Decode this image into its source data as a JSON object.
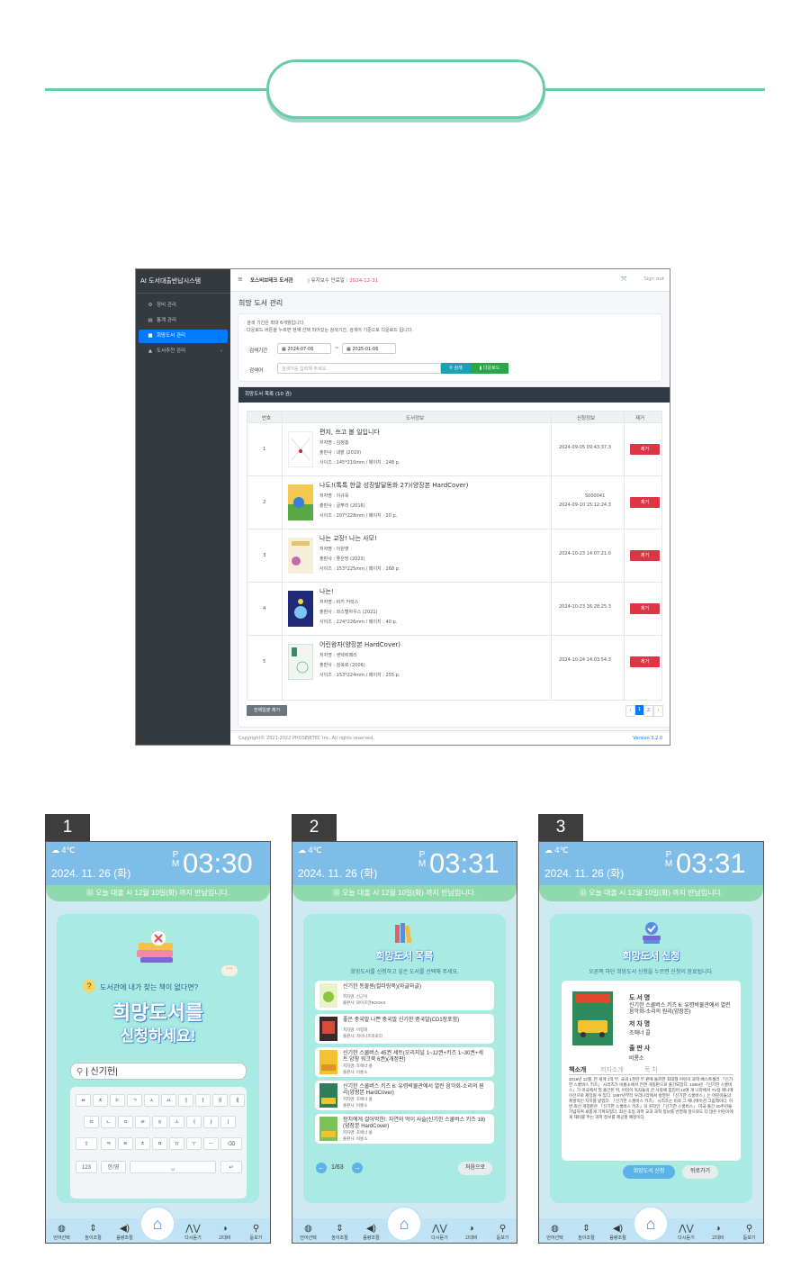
{
  "admin": {
    "brand": "AI 도서대출반납시스템",
    "sidebar": [
      {
        "label": "장비 관리",
        "icon": "gear-icon"
      },
      {
        "label": "통계 관리",
        "icon": "chart-icon"
      },
      {
        "label": "희망도서 관리",
        "icon": "book-icon"
      },
      {
        "label": "도서추천 관리",
        "icon": "thumb-icon"
      }
    ],
    "topbar": {
      "company": "포스비브테크 도서관",
      "maint_label": "유지보수 만료일 : ",
      "maint_date": "2024-12-31",
      "signout": "Sign out"
    },
    "page_title": "희망 도서 관리",
    "notes": [
      "· 검색 기간은 최대 6개월입니다.",
      "· 다운로드 버튼을 누르면 현재 선택 되어있는 검색기간, 검색어 기준으로 다운로드 됩니다."
    ],
    "search": {
      "period_label": "검색기간",
      "date_from": "2024-07-06",
      "tilde": "~",
      "date_to": "2025-01-06",
      "keyword_label": "검색어",
      "keyword_placeholder": "검색어를 입력해 주세요.",
      "search_btn": "검색",
      "download_btn": "다운로드"
    },
    "list_header": "희망도서 목록 (10 권)",
    "columns": [
      "번호",
      "도서정보",
      "신청정보",
      "제거"
    ],
    "remove_label": "제거",
    "rows": [
      {
        "no": "1",
        "title": "편지, 쓰고 볼 일입니다",
        "author": "저자명 : 김정흥",
        "publisher": "출판사 : 내밭 (2019)",
        "size": "사이즈 : 145*210mm / 페이지 : 248 p.",
        "req1": "2024-09-05 09:43:37.3",
        "req2": ""
      },
      {
        "no": "2",
        "title": "나도!(톡톡 한글 성장발달동화 27)(양장본 HardCover)",
        "author": "저자명 : 이규옥",
        "publisher": "출판사 : 글뿌리 (2016)",
        "size": "사이즈 : 207*228mm / 페이지 : 20 p.",
        "req1": "S000041",
        "req2": "2024-09-10 15:12:24.3"
      },
      {
        "no": "3",
        "title": "나는 교장! 나는 사모!",
        "author": "저자명 : 이원영",
        "publisher": "출판사 : 좋은땅 (2023)",
        "size": "사이즈 : 153*225mm / 페이지 : 268 p.",
        "req1": "2024-10-23 14:07:21.0",
        "req2": ""
      },
      {
        "no": "4",
        "title": "나는!",
        "author": "저자명 : 비키 커럭스",
        "publisher": "출판사 : 와스텔하우스 (2021)",
        "size": "사이즈 : 224*226mm / 페이지 : 40 p.",
        "req1": "2024-10-23 16:28:25.3",
        "req2": ""
      },
      {
        "no": "5",
        "title": "어린왕자(양장본 HardCover)",
        "author": "저자명 : 생텍쥐페리",
        "publisher": "출판사 : 검북로 (2006)",
        "size": "사이즈 : 153*224mm / 페이지 : 255 p.",
        "req1": "2024-10-24 14:03:54.3",
        "req2": ""
      }
    ],
    "remove_all": "전체일괄 제거",
    "pagination": [
      "‹",
      "1",
      "2",
      "›"
    ],
    "footer": {
      "copyright": "Copyright© 2021-2022 PHOSEIBTEC Inc. All rights reserved.",
      "version": "Version 3.2.0"
    }
  },
  "phones": [
    {
      "tab": "1",
      "temp": "4℃",
      "date": "2024. 11. 26 (화)",
      "ampm_p": "P",
      "ampm_m": "M",
      "time": "03:30",
      "notice": "오늘 대출 시 12월 10일(화) 까지 반납입니다.",
      "question": "도서관에 내가 찾는 책이 없다면?",
      "headline1": "희망도서를",
      "headline2": "신청하세요!",
      "search_value": "신기헌",
      "keys_row1": [
        "ㅂ",
        "ㅈ",
        "ㄷ",
        "ㄱ",
        "ㅅ",
        "ㅛ",
        "ㅕ",
        "ㅑ",
        "ㅐ",
        "ㅔ"
      ],
      "keys_row2": [
        "ㅁ",
        "ㄴ",
        "ㅇ",
        "ㄹ",
        "ㅎ",
        "ㅗ",
        "ㅓ",
        "ㅏ",
        "ㅣ"
      ],
      "keys_row3": [
        "ㅋ",
        "ㅌ",
        "ㅊ",
        "ㅍ",
        "ㅠ",
        "ㅜ",
        "ㅡ"
      ],
      "key_123": "123",
      "key_lang": "한/영"
    },
    {
      "tab": "2",
      "temp": "4℃",
      "date": "2024. 11. 26 (화)",
      "ampm_p": "P",
      "ampm_m": "M",
      "time": "03:31",
      "notice": "오늘 대출 시 12월 10일(화) 까지 반납입니다.",
      "title": "희망도서 목록",
      "subtitle": "희망도서를 신청하고 싶은 도서를 선택해 주세요.",
      "items": [
        {
          "title": "신기한 동물원(컬러링북)(와글와글)",
          "author": "저자명: 신군이",
          "publisher": "출판사: 와이즈만BOOKS"
        },
        {
          "title": "좋은 중국말 나쁜 중국말 신기한 중국말(CD1장포함)",
          "author": "저자명: 이정화",
          "publisher": "출판사: 차이나즈북로리"
        },
        {
          "title": "신기한 스쿨버스 45권 세트(오리지널 1~12권+키즈 1~30권+세트 양장 워크북 6권)(개정판)",
          "author": "저자명: 조애너 콜",
          "publisher": "출판사: 비룡소"
        },
        {
          "title": "신기한 스쿨버스 키즈 6: 유령박물관에서 열린 음악회-소리의 원리(양장본 HardCover)",
          "author": "저자명: 조애너 콜",
          "publisher": "출판사: 비룡소"
        },
        {
          "title": "장치에게 걸어먹힌!: 자연의 먹이 사슬(신기한 스쿨버스 키즈 18)(양장본 HardCover)",
          "author": "저자명: 조애너 콜",
          "publisher": "출판사: 비룡소"
        }
      ],
      "page": "1/63",
      "first_btn": "처음으로"
    },
    {
      "tab": "3",
      "temp": "4℃",
      "date": "2024. 11. 26 (화)",
      "ampm_p": "P",
      "ampm_m": "M",
      "time": "03:31",
      "notice": "오늘 대출 시 12월 10일(화) 까지 반납입니다.",
      "title": "희망도서 신청",
      "subtitle": "오른쪽 하단 희망도서 신청을 누르면 신청이 완료됩니다.",
      "book_label": "도 서 명",
      "book_title": "신기한 스쿨버스 키즈 6: 유령박물관에서 열린 음악회-소리의 원리(양장본)",
      "author_label": "저 자 명",
      "author": "조애너 콜",
      "publisher_label": "출 판 사",
      "publisher": "비룡소",
      "tabs": [
        "책소개",
        "저자소개",
        "목 차"
      ],
      "description": "2018년 12월, 전 세계 1억 부, 국내 1천만 부 판매 돌파한 최대형 어린이 과학 베스트셀러 「신기한 스쿨버스 키즈」 시리즈가 비룡소에서 전면 개정판으로 출간되었다. 1980년 「신기한 스쿨버스」가 미국에서 첫 출간된 뒤, 어린이 독자들의 큰 사랑에 힘입어 10여 개 나라에서 TV용 애니메이션으로 제작될 수 있다. 1997년부터 우리나라에서 방영된 「신기한 스쿨버스」는 어린이들의 폭발적인 지지를 받았다. 「신기한 스쿨버스 키즈」 시리즈는 비로 그 애니메이션 그림책이다. 이번 최신 개정판은 「신기한 스쿨버스 키즈」의 원작인 「신기한 스쿨버스」 미국 출간 20주년을 기념하여 새롭게 기획되었다. 최신 초등 과학 교과 과학 정보를 반영해 앞으로도 더 많은 어린이에게 재미를 주는 과학 정보를 제공할 예정이다.",
      "apply_btn": "희망도서 신청",
      "back_btn": "뒤로가기"
    }
  ],
  "nav": [
    "언어선택",
    "높이조절",
    "음량조절",
    "홈",
    "다시듣기",
    "고대비",
    "돋보기"
  ]
}
